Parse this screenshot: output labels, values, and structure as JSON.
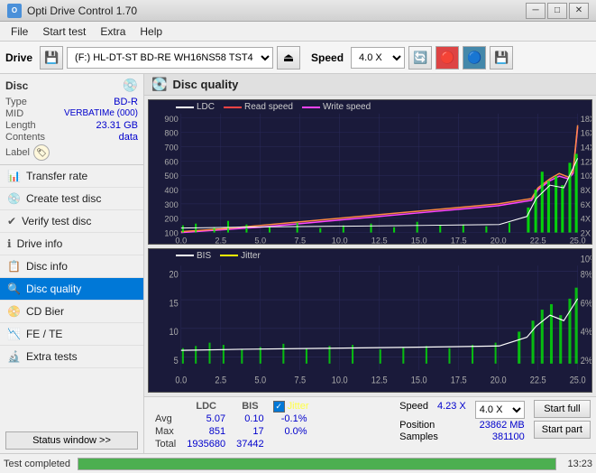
{
  "titlebar": {
    "title": "Opti Drive Control 1.70",
    "icon_text": "O",
    "min_label": "─",
    "max_label": "□",
    "close_label": "✕"
  },
  "menubar": {
    "items": [
      "File",
      "Start test",
      "Extra",
      "Help"
    ]
  },
  "toolbar": {
    "drive_label": "Drive",
    "drive_value": "(F:)  HL-DT-ST BD-RE  WH16NS58 TST4",
    "speed_label": "Speed",
    "speed_value": "4.0 X"
  },
  "sidebar": {
    "disc_title": "Disc",
    "disc_icon": "💿",
    "disc_fields": [
      {
        "label": "Type",
        "value": "BD-R"
      },
      {
        "label": "MID",
        "value": "VERBATIMe (000)"
      },
      {
        "label": "Length",
        "value": "23.31 GB"
      },
      {
        "label": "Contents",
        "value": "data"
      },
      {
        "label": "Label",
        "value": ""
      }
    ],
    "nav_items": [
      {
        "id": "transfer-rate",
        "label": "Transfer rate",
        "icon": "📊"
      },
      {
        "id": "create-test-disc",
        "label": "Create test disc",
        "icon": "💿"
      },
      {
        "id": "verify-test-disc",
        "label": "Verify test disc",
        "icon": "✔"
      },
      {
        "id": "drive-info",
        "label": "Drive info",
        "icon": "ℹ"
      },
      {
        "id": "disc-info",
        "label": "Disc info",
        "icon": "📋"
      },
      {
        "id": "disc-quality",
        "label": "Disc quality",
        "icon": "🔍",
        "active": true
      },
      {
        "id": "cd-bier",
        "label": "CD Bier",
        "icon": "📀"
      },
      {
        "id": "fe-te",
        "label": "FE / TE",
        "icon": "📉"
      },
      {
        "id": "extra-tests",
        "label": "Extra tests",
        "icon": "🔬"
      }
    ],
    "status_window_label": "Status window >>"
  },
  "content": {
    "title": "Disc quality",
    "icon": "💽"
  },
  "chart1": {
    "legend": [
      {
        "label": "LDC",
        "color": "#ffffff"
      },
      {
        "label": "Read speed",
        "color": "#ff6666"
      },
      {
        "label": "Write speed",
        "color": "#ff66ff"
      }
    ],
    "y_max": 900,
    "y_right_max": 18,
    "x_max": 25,
    "x_labels": [
      "0.0",
      "2.5",
      "5.0",
      "7.5",
      "10.0",
      "12.5",
      "15.0",
      "17.5",
      "20.0",
      "22.5",
      "25.0"
    ],
    "y_left_labels": [
      "100",
      "200",
      "300",
      "400",
      "500",
      "600",
      "700",
      "800",
      "900"
    ],
    "y_right_labels": [
      "2X",
      "4X",
      "6X",
      "8X",
      "10X",
      "12X",
      "14X",
      "16X",
      "18X"
    ]
  },
  "chart2": {
    "legend": [
      {
        "label": "BIS",
        "color": "#ffffff"
      },
      {
        "label": "Jitter",
        "color": "#ffff00"
      }
    ],
    "y_max": 20,
    "y_right_max": 10,
    "x_max": 25,
    "x_labels": [
      "0.0",
      "2.5",
      "5.0",
      "7.5",
      "10.0",
      "12.5",
      "15.0",
      "17.5",
      "20.0",
      "22.5",
      "25.0"
    ],
    "y_left_labels": [
      "5",
      "10",
      "15",
      "20"
    ],
    "y_right_labels": [
      "2%",
      "4%",
      "6%",
      "8%",
      "10%"
    ]
  },
  "stats": {
    "headers": [
      "LDC",
      "BIS",
      "",
      "Jitter",
      "Speed",
      "4.23 X",
      "4.0 X"
    ],
    "rows": [
      {
        "label": "Avg",
        "ldc": "5.07",
        "bis": "0.10",
        "jitter": "-0.1%"
      },
      {
        "label": "Max",
        "ldc": "851",
        "bis": "17",
        "jitter": "0.0%"
      },
      {
        "label": "Total",
        "ldc": "1935680",
        "bis": "37442",
        "jitter": ""
      }
    ],
    "position_label": "Position",
    "position_value": "23862 MB",
    "samples_label": "Samples",
    "samples_value": "381100",
    "start_full_label": "Start full",
    "start_part_label": "Start part",
    "jitter_checked": true,
    "speed_display": "4.23 X",
    "speed_select": "4.0 X"
  },
  "statusbar": {
    "text": "Test completed",
    "progress": 100,
    "time": "13:23"
  }
}
